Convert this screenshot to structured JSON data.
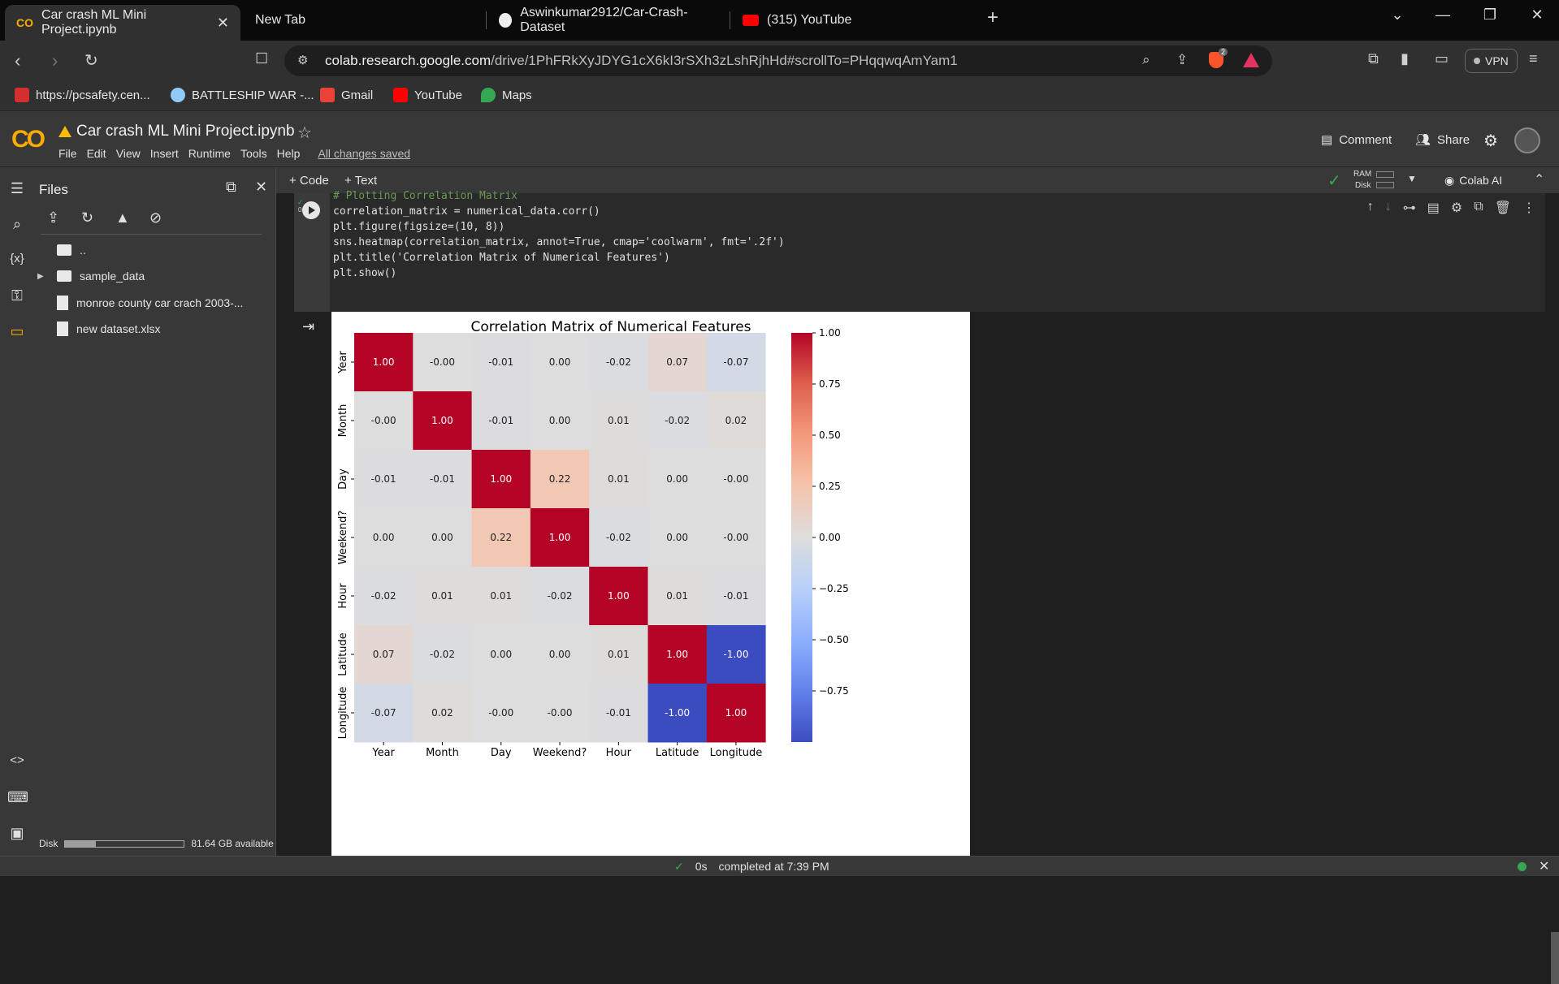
{
  "browser": {
    "tabs": [
      {
        "label": "Car crash ML Mini Project.ipynb",
        "active": true
      },
      {
        "label": "New Tab"
      },
      {
        "label": "Aswinkumar2912/Car-Crash-Dataset"
      },
      {
        "label": "(315) YouTube"
      }
    ],
    "url_host": "colab.research.google.com",
    "url_path": "/drive/1PhFRkXyJDYG1cX6kI3rSXh3zLshRjhHd#scrollTo=PHqqwqAmYam1",
    "vpn_label": "VPN",
    "brave_badge": "2",
    "bookmarks": [
      {
        "label": "https://pcsafety.cen...",
        "color": "#d32f2f"
      },
      {
        "label": "BATTLESHIP WAR -...",
        "color": "#90caf9"
      },
      {
        "label": "Gmail",
        "color": "#ea4335"
      },
      {
        "label": "YouTube",
        "color": "#ff0000"
      },
      {
        "label": "Maps",
        "color": "#34a853"
      }
    ]
  },
  "colab": {
    "logo": "CO",
    "notebook_title": "Car crash ML Mini Project.ipynb",
    "menus": [
      "File",
      "Edit",
      "View",
      "Insert",
      "Runtime",
      "Tools",
      "Help"
    ],
    "saved_status": "All changes saved",
    "comment_label": "Comment",
    "share_label": "Share",
    "add_code_label": "+ Code",
    "add_text_label": "+ Text",
    "ram_label": "RAM",
    "disk_label": "Disk",
    "colab_ai_label": "Colab AI"
  },
  "files_panel": {
    "title": "Files",
    "parent_dir": "..",
    "items": [
      {
        "label": "sample_data",
        "type": "folder"
      },
      {
        "label": "monroe county car crach 2003-...",
        "type": "file"
      },
      {
        "label": "new dataset.xlsx",
        "type": "file"
      }
    ],
    "disk_label": "Disk",
    "disk_available": "81.64 GB available"
  },
  "cell": {
    "exec_time": "0s",
    "lines": [
      "# Plotting Correlation Matrix",
      "correlation_matrix = numerical_data.corr()",
      "plt.figure(figsize=(10, 8))",
      "sns.heatmap(correlation_matrix, annot=True, cmap='coolwarm', fmt='.2f')",
      "plt.title('Correlation Matrix of Numerical Features')",
      "plt.show()"
    ]
  },
  "status": {
    "check": "✓",
    "time": "0s",
    "message": "completed at 7:39 PM"
  },
  "chart_data": {
    "type": "heatmap",
    "title": "Correlation Matrix of Numerical Features",
    "labels": [
      "Year",
      "Month",
      "Day",
      "Weekend?",
      "Hour",
      "Latitude",
      "Longitude"
    ],
    "values": [
      [
        1.0,
        -0.0,
        -0.01,
        0.0,
        -0.02,
        0.07,
        -0.07
      ],
      [
        -0.0,
        1.0,
        -0.01,
        0.0,
        0.01,
        -0.02,
        0.02
      ],
      [
        -0.01,
        -0.01,
        1.0,
        0.22,
        0.01,
        0.0,
        -0.0
      ],
      [
        0.0,
        0.0,
        0.22,
        1.0,
        -0.02,
        0.0,
        -0.0
      ],
      [
        -0.02,
        0.01,
        0.01,
        -0.02,
        1.0,
        0.01,
        -0.01
      ],
      [
        0.07,
        -0.02,
        0.0,
        0.0,
        0.01,
        1.0,
        -1.0
      ],
      [
        -0.07,
        0.02,
        -0.0,
        -0.0,
        -0.01,
        -1.0,
        1.0
      ]
    ],
    "annot_text": [
      [
        "1.00",
        "-0.00",
        "-0.01",
        "0.00",
        "-0.02",
        "0.07",
        "-0.07"
      ],
      [
        "-0.00",
        "1.00",
        "-0.01",
        "0.00",
        "0.01",
        "-0.02",
        "0.02"
      ],
      [
        "-0.01",
        "-0.01",
        "1.00",
        "0.22",
        "0.01",
        "0.00",
        "-0.00"
      ],
      [
        "0.00",
        "0.00",
        "0.22",
        "1.00",
        "-0.02",
        "0.00",
        "-0.00"
      ],
      [
        "-0.02",
        "0.01",
        "0.01",
        "-0.02",
        "1.00",
        "0.01",
        "-0.01"
      ],
      [
        "0.07",
        "-0.02",
        "0.00",
        "0.00",
        "0.01",
        "1.00",
        "-1.00"
      ],
      [
        "-0.07",
        "0.02",
        "-0.00",
        "-0.00",
        "-0.01",
        "-1.00",
        "1.00"
      ]
    ],
    "colormap": "coolwarm",
    "colorbar_ticks": [
      1.0,
      0.75,
      0.5,
      0.25,
      0.0,
      -0.25,
      -0.5,
      -0.75
    ],
    "colorbar_tick_labels": [
      "1.00",
      "0.75",
      "0.50",
      "0.25",
      "0.00",
      "−0.25",
      "−0.50",
      "−0.75"
    ],
    "vmin": -1.0,
    "vmax": 1.0
  }
}
